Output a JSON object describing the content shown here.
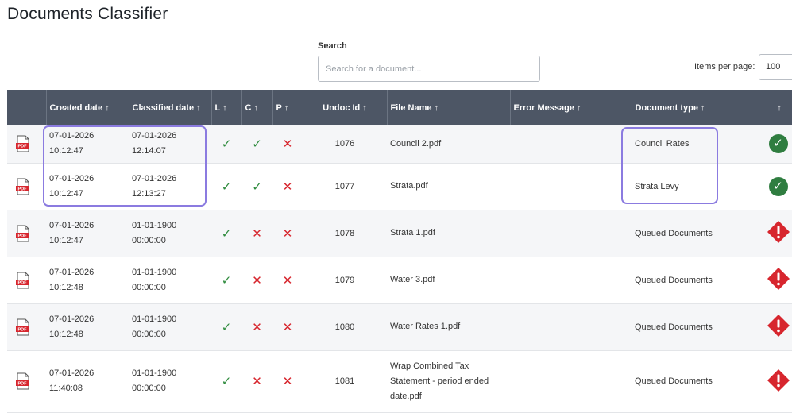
{
  "page": {
    "title": "Documents Classifier"
  },
  "search": {
    "label": "Search",
    "placeholder": "Search for a document..."
  },
  "pagination": {
    "items_per_page_label": "Items per page:",
    "items_per_page_value": "100"
  },
  "table": {
    "columns": [
      {
        "label": "",
        "arrow": ""
      },
      {
        "label": "Created date",
        "arrow": "↑"
      },
      {
        "label": "Classified date",
        "arrow": "↑"
      },
      {
        "label": "L",
        "arrow": "↑"
      },
      {
        "label": "C",
        "arrow": "↑"
      },
      {
        "label": "P",
        "arrow": "↑"
      },
      {
        "label": "Undoc Id",
        "arrow": "↑"
      },
      {
        "label": "File Name",
        "arrow": "↑"
      },
      {
        "label": "Error Message",
        "arrow": "↑"
      },
      {
        "label": "Document type",
        "arrow": "↑"
      },
      {
        "label": "",
        "arrow": "↑"
      }
    ],
    "rows": [
      {
        "file_icon": "pdf-icon",
        "created_date": "07-01-2026",
        "created_time": "10:12:47",
        "classified_date": "07-01-2026",
        "classified_time": "12:14:07",
        "l": "check",
        "c": "check",
        "p": "cross",
        "undoc_id": "1076",
        "file_name": "Council 2.pdf",
        "error_message": "",
        "document_type": "Council Rates",
        "status": "success"
      },
      {
        "file_icon": "pdf-icon",
        "created_date": "07-01-2026",
        "created_time": "10:12:47",
        "classified_date": "07-01-2026",
        "classified_time": "12:13:27",
        "l": "check",
        "c": "check",
        "p": "cross",
        "undoc_id": "1077",
        "file_name": "Strata.pdf",
        "error_message": "",
        "document_type": "Strata Levy",
        "status": "success"
      },
      {
        "file_icon": "pdf-icon",
        "created_date": "07-01-2026",
        "created_time": "10:12:47",
        "classified_date": "01-01-1900",
        "classified_time": "00:00:00",
        "l": "check",
        "c": "cross",
        "p": "cross",
        "undoc_id": "1078",
        "file_name": "Strata 1.pdf",
        "error_message": "",
        "document_type": "Queued Documents",
        "status": "warning"
      },
      {
        "file_icon": "pdf-icon",
        "created_date": "07-01-2026",
        "created_time": "10:12:48",
        "classified_date": "01-01-1900",
        "classified_time": "00:00:00",
        "l": "check",
        "c": "cross",
        "p": "cross",
        "undoc_id": "1079",
        "file_name": "Water 3.pdf",
        "error_message": "",
        "document_type": "Queued Documents",
        "status": "warning"
      },
      {
        "file_icon": "pdf-icon",
        "created_date": "07-01-2026",
        "created_time": "10:12:48",
        "classified_date": "01-01-1900",
        "classified_time": "00:00:00",
        "l": "check",
        "c": "cross",
        "p": "cross",
        "undoc_id": "1080",
        "file_name": "Water Rates 1.pdf",
        "error_message": "",
        "document_type": "Queued Documents",
        "status": "warning"
      },
      {
        "file_icon": "pdf-icon",
        "created_date": "07-01-2026",
        "created_time": "11:40:08",
        "classified_date": "01-01-1900",
        "classified_time": "00:00:00",
        "l": "check",
        "c": "cross",
        "p": "cross",
        "undoc_id": "1081",
        "file_name": "Wrap Combined Tax Statement - period ended date.pdf",
        "error_message": "",
        "document_type": "Queued Documents",
        "status": "warning"
      }
    ]
  },
  "colors": {
    "header_bg": "#4d5665",
    "check": "#2e8b3d",
    "cross": "#d7262e",
    "success": "#2f7d40",
    "warning": "#d7262e",
    "highlight": "#8b7be0"
  }
}
